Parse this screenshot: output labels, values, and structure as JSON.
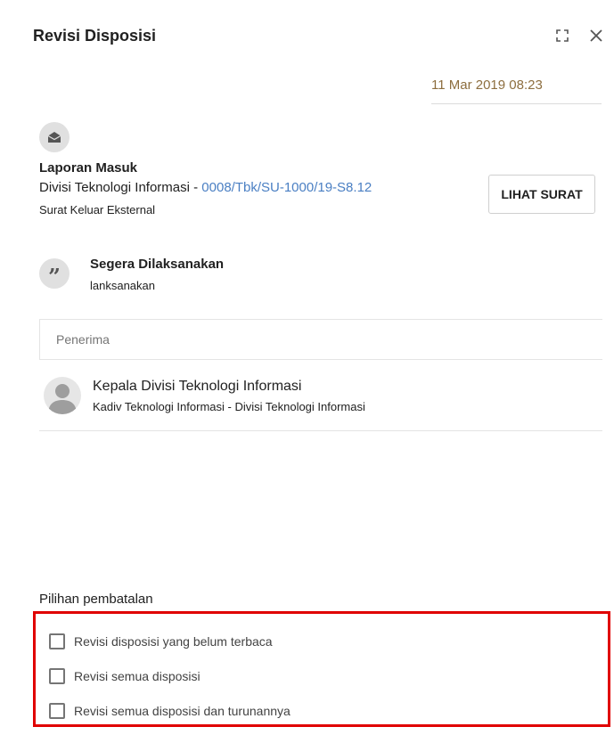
{
  "dialog": {
    "title": "Revisi Disposisi",
    "date": "11 Mar 2019 08:23"
  },
  "letter": {
    "type_label": "Laporan Masuk",
    "origin": "Divisi Teknologi Informasi - ",
    "number": "0008/Tbk/SU-1000/19-S8.12",
    "category": "Surat Keluar Eksternal",
    "view_button": "LIHAT SURAT"
  },
  "instruction": {
    "title": "Segera Dilaksanakan",
    "note": "lanksanakan"
  },
  "recipients": {
    "header": "Penerima",
    "items": [
      {
        "name": "Kepala Divisi Teknologi Informasi",
        "detail": "Kadiv Teknologi Informasi - Divisi Teknologi Informasi"
      }
    ]
  },
  "cancel_options": {
    "title": "Pilihan pembatalan",
    "options": [
      {
        "label": "Revisi disposisi yang belum terbaca",
        "checked": false
      },
      {
        "label": "Revisi semua disposisi",
        "checked": false
      },
      {
        "label": "Revisi semua disposisi dan turunannya",
        "checked": false
      }
    ],
    "highlight_color": "#e00000"
  },
  "colors": {
    "link": "#4a7fc3",
    "date": "#8d6e3f"
  },
  "icons": {
    "fullscreen": "fullscreen-icon",
    "close": "close-icon",
    "mail": "mail-open-icon",
    "quote": "quote-icon",
    "person": "person-icon"
  }
}
